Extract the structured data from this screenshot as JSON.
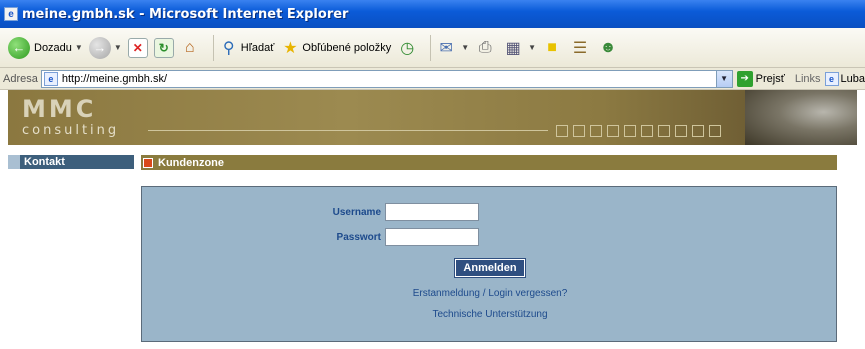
{
  "window": {
    "title": "meine.gmbh.sk - Microsoft Internet Explorer"
  },
  "toolbar": {
    "back_label": "Dozadu",
    "search_label": "Hľadať",
    "favorites_label": "Obľúbené položky"
  },
  "addressbar": {
    "label": "Adresa",
    "url": "http://meine.gmbh.sk/",
    "go_label": "Prejsť",
    "links_label": "Links",
    "link_item": "Luba"
  },
  "banner": {
    "logo_top": "MMC",
    "logo_bottom": "consulting"
  },
  "nav": {
    "kontakt": "Kontakt"
  },
  "section": {
    "title": "Kundenzone"
  },
  "login": {
    "username_label": "Username",
    "password_label": "Passwort",
    "submit_label": "Anmelden",
    "register_link": "Erstanmeldung / Login vergessen?",
    "support_link": "Technische Unterstützung"
  },
  "colors": {
    "titlebar": "#0b5bd8",
    "banner": "#8b7840",
    "nav": "#3d5f7c",
    "section_bar": "#8a7b3e",
    "login_panel": "#9ab5c9",
    "label_text": "#1d4a8c",
    "button": "#2f4f80"
  }
}
